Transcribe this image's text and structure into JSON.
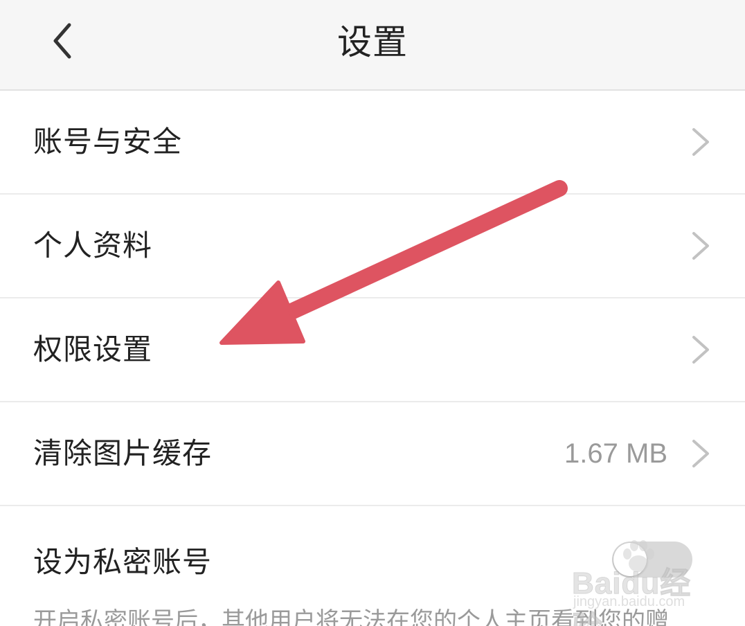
{
  "header": {
    "title": "设置",
    "back_icon": "chevron-left-icon"
  },
  "settings": [
    {
      "label": "账号与安全",
      "value": ""
    },
    {
      "label": "个人资料",
      "value": ""
    },
    {
      "label": "权限设置",
      "value": ""
    },
    {
      "label": "清除图片缓存",
      "value": "1.67 MB"
    }
  ],
  "private_account": {
    "label": "设为私密账号",
    "description": "开启私密账号后，其他用户将无法在您的个人主页看到您的赠",
    "toggle_on": false
  },
  "watermark": {
    "logo": "Baidu经验",
    "url": "jingyan.baidu.com"
  },
  "colors": {
    "header_bg": "#f6f6f6",
    "annotation_arrow": "#de5461",
    "text_primary": "#222222",
    "text_secondary": "#9a9a9a"
  }
}
